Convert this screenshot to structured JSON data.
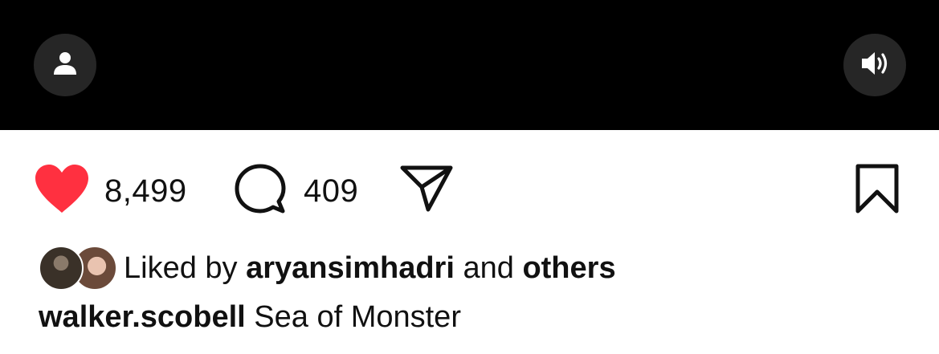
{
  "video": {
    "profile_icon": "person-icon",
    "sound_icon": "speaker-on-icon",
    "background_color": "#000000",
    "button_color": "#262626"
  },
  "actions": {
    "like": {
      "icon": "heart-filled-icon",
      "count": "8,499",
      "color": "#ff3040"
    },
    "comment": {
      "icon": "comment-bubble-icon",
      "count": "409"
    },
    "share": {
      "icon": "paper-plane-icon"
    },
    "save": {
      "icon": "bookmark-icon"
    }
  },
  "liked_by": {
    "prefix": "Liked by",
    "user": "aryansimhadri",
    "connector": "and",
    "others": "others"
  },
  "caption": {
    "username": "walker.scobell",
    "text": "Sea of Monster"
  }
}
